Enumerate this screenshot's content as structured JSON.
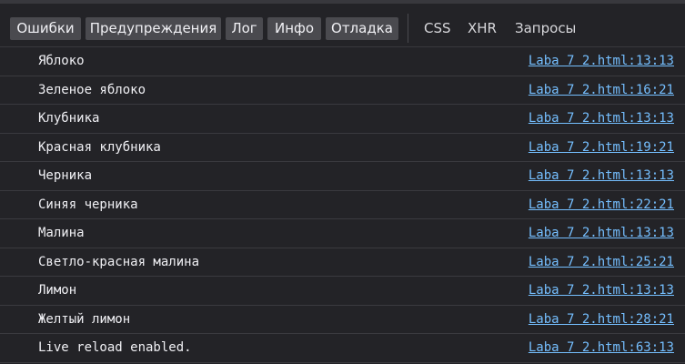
{
  "toolbar": {
    "filters": [
      {
        "label": "Ошибки"
      },
      {
        "label": "Предупреждения"
      },
      {
        "label": "Лог"
      },
      {
        "label": "Инфо"
      },
      {
        "label": "Отладка"
      }
    ],
    "request_filters": [
      {
        "label": "CSS"
      },
      {
        "label": "XHR"
      },
      {
        "label": "Запросы"
      }
    ]
  },
  "messages": [
    {
      "text": "Яблоко",
      "location": "Laba 7 2.html:13:13"
    },
    {
      "text": "Зеленое яблоко",
      "location": "Laba 7 2.html:16:21"
    },
    {
      "text": "Клубника",
      "location": "Laba 7 2.html:13:13"
    },
    {
      "text": "Красная клубника",
      "location": "Laba 7 2.html:19:21"
    },
    {
      "text": "Черника",
      "location": "Laba 7 2.html:13:13"
    },
    {
      "text": "Синяя черника",
      "location": "Laba 7 2.html:22:21"
    },
    {
      "text": "Малина",
      "location": "Laba 7 2.html:13:13"
    },
    {
      "text": "Светло-красная малина",
      "location": "Laba 7 2.html:25:21"
    },
    {
      "text": "Лимон",
      "location": "Laba 7 2.html:13:13"
    },
    {
      "text": "Желтый лимон",
      "location": "Laba 7 2.html:28:21"
    },
    {
      "text": "Live reload enabled.",
      "location": "Laba 7 2.html:63:13"
    }
  ],
  "colors": {
    "background": "#232327",
    "button_bg": "#4a4a4f",
    "text": "#f0f0f4",
    "link": "#75bfff",
    "divider": "#3a3a3f"
  }
}
